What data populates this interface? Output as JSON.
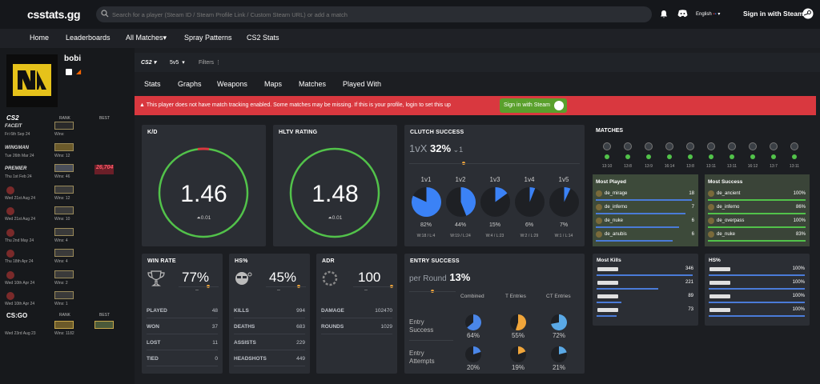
{
  "header": {
    "logo": "csstats.gg",
    "search_placeholder": "Search for a player (Steam ID / Steam Profile Link / Custom Steam URL) or add a match",
    "language": "English",
    "sign_in": "Sign in with Steam"
  },
  "nav": [
    "Home",
    "Leaderboards",
    "All Matches",
    "Spray Patterns",
    "CS2 Stats"
  ],
  "player": {
    "name": "bobi"
  },
  "ranks": {
    "cs2_label": "CS2",
    "rank_header": "RANK",
    "best_header": "BEST",
    "rows": [
      {
        "source": "FACEIT",
        "date": "Fri 6th Sep 24",
        "wins": "Wins: "
      },
      {
        "source": "WINGMAN",
        "date": "Tue 26th Mar 24",
        "wins": "Wins: 12"
      },
      {
        "source": "PREMIER",
        "date": "Thu 1st Feb 24",
        "wins": "Wins: 46",
        "rating": "26,704"
      },
      {
        "source": "",
        "date": "Wed 21st Aug 24",
        "wins": "Wins: 12"
      },
      {
        "source": "",
        "date": "Wed 21st Aug 24",
        "wins": "Wins: 10"
      },
      {
        "source": "",
        "date": "Thu 2nd May 24",
        "wins": "Wins: 4"
      },
      {
        "source": "",
        "date": "Thu 18th Apr 24",
        "wins": "Wins: 4"
      },
      {
        "source": "",
        "date": "Wed 10th Apr 24",
        "wins": "Wins: 2"
      },
      {
        "source": "",
        "date": "Wed 10th Apr 24",
        "wins": "Wins: 1"
      }
    ],
    "csgo_label": "GO",
    "csgo_date": "Wed 23rd Aug 23",
    "csgo_wins": "Wins: 1182"
  },
  "filters": {
    "game": "CS2",
    "mode": "5v5",
    "filters": "Filters"
  },
  "tabs": [
    "Stats",
    "Graphs",
    "Weapons",
    "Maps",
    "Matches",
    "Played With"
  ],
  "warning": {
    "text": "This player does not have match tracking enabled. Some matches may be missing. If this is your profile, login to set this up",
    "button": "Sign in with Steam"
  },
  "kd": {
    "title": "K/D",
    "value": "1.46",
    "delta": "0.01"
  },
  "hltv": {
    "title": "HLTV RATING",
    "value": "1.48",
    "delta": "0.01"
  },
  "clutch": {
    "title": "CLUTCH SUCCESS",
    "prefix": "1vX",
    "value": "32%",
    "sub": "1",
    "items": [
      {
        "label": "1v1",
        "pct": "82%",
        "wl": "W:18 / L:4",
        "frac": 0.82
      },
      {
        "label": "1v2",
        "pct": "44%",
        "wl": "W:19 / L:24",
        "frac": 0.44
      },
      {
        "label": "1v3",
        "pct": "15%",
        "wl": "W:4 / L:23",
        "frac": 0.15
      },
      {
        "label": "1v4",
        "pct": "6%",
        "wl": "W:2 / L:29",
        "frac": 0.06
      },
      {
        "label": "1v5",
        "pct": "7%",
        "wl": "W:1 / L:14",
        "frac": 0.07
      }
    ]
  },
  "matches": {
    "title": "MATCHES",
    "dates": [
      "13:10",
      "13:8",
      "13:9",
      "16:14",
      "13:8",
      "13:11",
      "13:11",
      "16:12",
      "13:7",
      "13:11"
    ],
    "results": [
      "g",
      "g",
      "g",
      "g",
      "g",
      "r",
      "g",
      "g",
      "g",
      "g"
    ]
  },
  "most_played": {
    "title": "Most Played",
    "maps": [
      {
        "name": "de_mirage",
        "val": "18"
      },
      {
        "name": "de_inferno",
        "val": "7"
      },
      {
        "name": "de_nuke",
        "val": "6"
      },
      {
        "name": "de_anubis",
        "val": "6"
      }
    ]
  },
  "most_success": {
    "title": "Most Success",
    "maps": [
      {
        "name": "de_ancient",
        "val": "100%"
      },
      {
        "name": "de_inferno",
        "val": "86%"
      },
      {
        "name": "de_overpass",
        "val": "100%"
      },
      {
        "name": "de_nuke",
        "val": "83%"
      }
    ]
  },
  "winrate": {
    "title": "WIN RATE",
    "value": "77%",
    "dash": "–",
    "rows": [
      {
        "k": "PLAYED",
        "v": "48"
      },
      {
        "k": "WON",
        "v": "37"
      },
      {
        "k": "LOST",
        "v": "11"
      },
      {
        "k": "TIED",
        "v": "0"
      }
    ]
  },
  "hs": {
    "title": "HS%",
    "value": "45%",
    "dash": "–",
    "rows": [
      {
        "k": "KILLS",
        "v": "994"
      },
      {
        "k": "DEATHS",
        "v": "683"
      },
      {
        "k": "ASSISTS",
        "v": "229"
      },
      {
        "k": "HEADSHOTS",
        "v": "449"
      }
    ]
  },
  "adr": {
    "title": "ADR",
    "value": "100",
    "dash": "–",
    "rows": [
      {
        "k": "DAMAGE",
        "v": "102470"
      },
      {
        "k": "ROUNDS",
        "v": "1029"
      }
    ]
  },
  "entry": {
    "title": "ENTRY SUCCESS",
    "prefix": "per Round",
    "value": "13%",
    "cols": [
      "Combined",
      "T Entries",
      "CT Entries"
    ],
    "success_label": "Entry Success",
    "success": [
      {
        "pct": "64%",
        "frac": 0.64,
        "color": "#4a86e8"
      },
      {
        "pct": "55%",
        "frac": 0.55,
        "color": "#f0a53a"
      },
      {
        "pct": "72%",
        "frac": 0.72,
        "color": "#5aa9e6"
      }
    ],
    "attempts_label": "Entry Attempts",
    "attempts": [
      {
        "pct": "20%",
        "frac": 0.2,
        "color": "#4a86e8"
      },
      {
        "pct": "19%",
        "frac": 0.19,
        "color": "#f0a53a"
      },
      {
        "pct": "21%",
        "frac": 0.21,
        "color": "#5aa9e6"
      }
    ]
  },
  "most_kills": {
    "title": "Most Kills",
    "rows": [
      {
        "v": "346",
        "frac": 1
      },
      {
        "v": "221",
        "frac": 0.64
      },
      {
        "v": "89",
        "frac": 0.26
      },
      {
        "v": "73",
        "frac": 0.21
      }
    ]
  },
  "hs_weapons": {
    "title": "HS%",
    "rows": [
      {
        "v": "100%"
      },
      {
        "v": "100%"
      },
      {
        "v": "100%"
      },
      {
        "v": "100%"
      }
    ]
  }
}
